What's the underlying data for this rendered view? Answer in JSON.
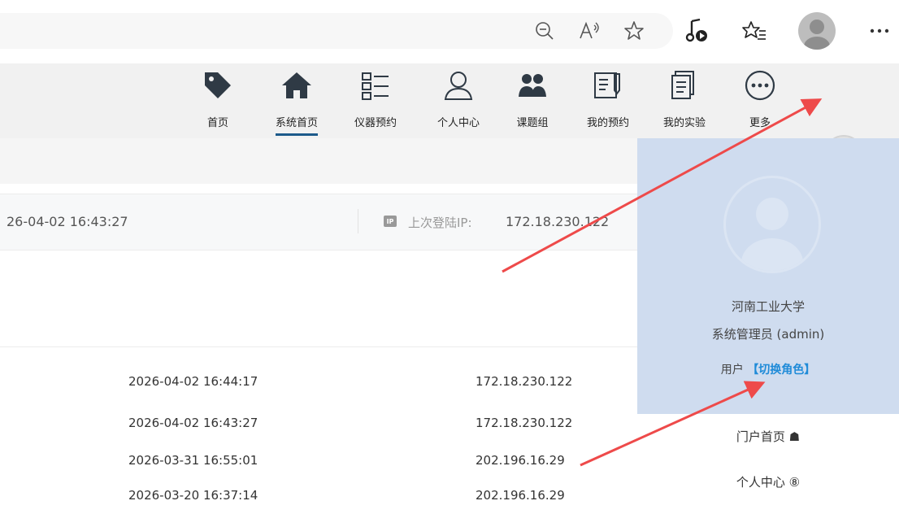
{
  "nav": {
    "items": [
      {
        "label": "首页",
        "icon": "tag-icon"
      },
      {
        "label": "系统首页",
        "icon": "home-icon"
      },
      {
        "label": "仪器预约",
        "icon": "list-icon"
      },
      {
        "label": "个人中心",
        "icon": "user-icon"
      },
      {
        "label": "课题组",
        "icon": "group-icon"
      },
      {
        "label": "我的预约",
        "icon": "document-edit-icon"
      },
      {
        "label": "我的实验",
        "icon": "documents-icon"
      },
      {
        "label": "更多",
        "icon": "more-icon"
      }
    ],
    "active_index": 1
  },
  "last_login": {
    "date": "26-04-02 16:43:27",
    "ip_badge": "IP",
    "ip_label": "上次登陆IP:",
    "ip_value": "172.18.230.122"
  },
  "login_log": [
    {
      "time": "2026-04-02 16:44:17",
      "ip": "172.18.230.122"
    },
    {
      "time": "2026-04-02 16:43:27",
      "ip": "172.18.230.122"
    },
    {
      "time": "2026-03-31 16:55:01",
      "ip": "202.196.16.29"
    },
    {
      "time": "2026-03-20 16:37:14",
      "ip": "202.196.16.29"
    }
  ],
  "user_panel": {
    "organization": "河南工业大学",
    "role": "系统管理员 (admin)",
    "user_type": "用户",
    "switch_role": "【切换角色】",
    "menu": [
      {
        "label": "门户首页 ☗"
      },
      {
        "label": "个人中心 ⑧"
      }
    ]
  },
  "colors": {
    "accent_blue": "#1f8bd8",
    "panel_bg": "#cfdcef",
    "active_underline": "#1c5a8a",
    "annotation_arrow": "#ee4a4a"
  }
}
